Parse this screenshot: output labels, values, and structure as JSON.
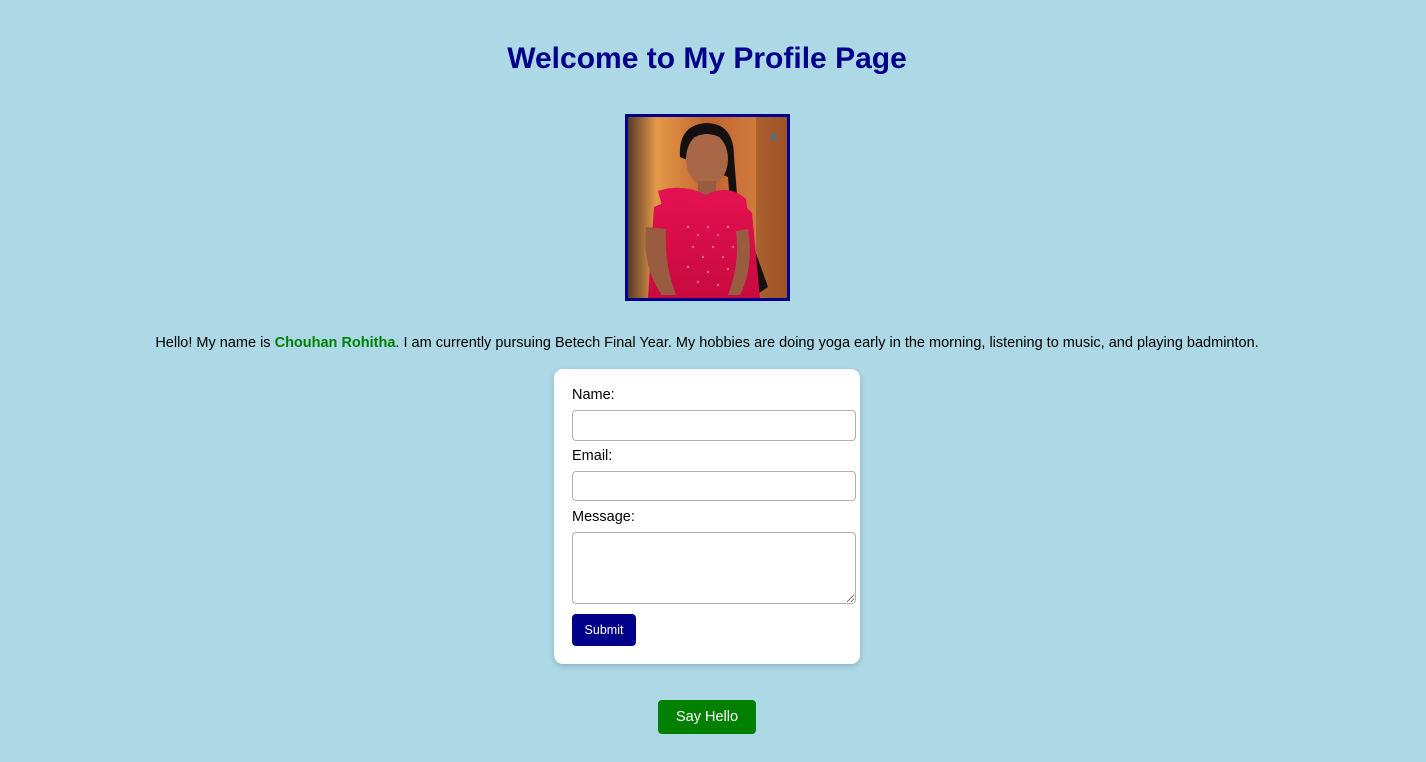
{
  "header": {
    "title": "Welcome to My Profile Page"
  },
  "profile": {
    "photo_name": "profile-photo",
    "intro_before": "Hello! My name is ",
    "name": "Chouhan Rohitha",
    "intro_after": ". I am currently pursuing Betech Final Year. My hobbies are doing yoga early in the morning, listening to music, and playing badminton.",
    "name_color": "#008000"
  },
  "form": {
    "name_label": "Name:",
    "name_value": "",
    "email_label": "Email:",
    "email_value": "",
    "message_label": "Message:",
    "message_value": "",
    "submit_label": "Submit"
  },
  "actions": {
    "say_hello_label": "Say Hello"
  },
  "colors": {
    "background": "#add8e6",
    "accent": "#00008b",
    "hello_button": "#008000"
  }
}
